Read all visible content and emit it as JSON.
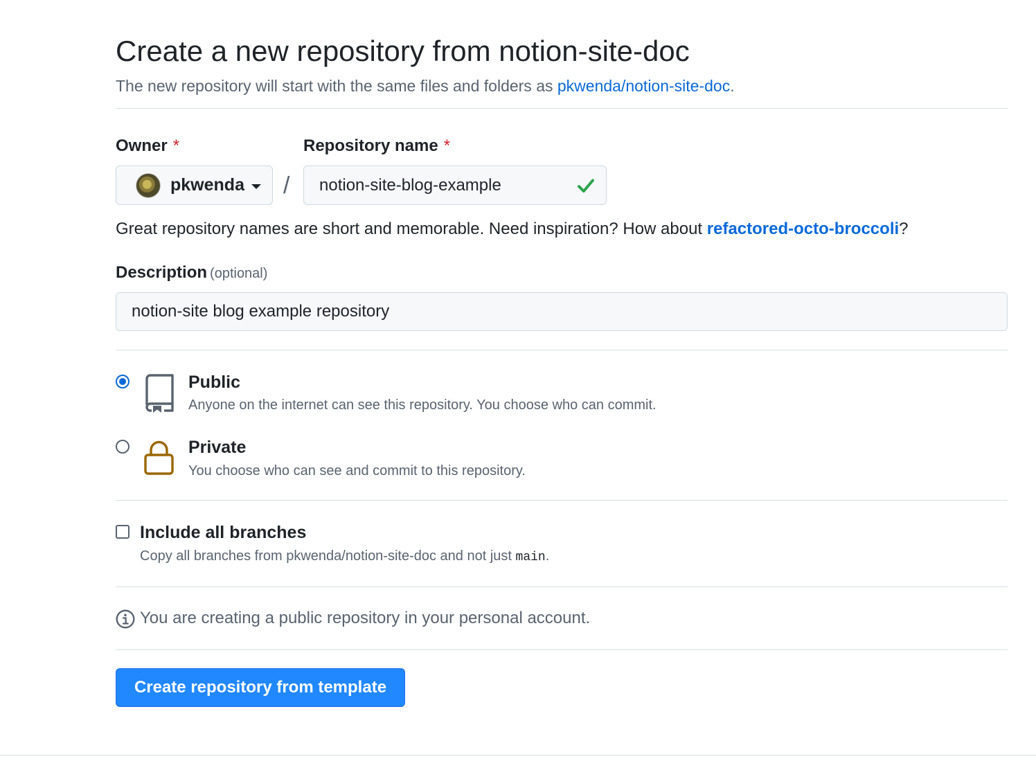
{
  "header": {
    "title": "Create a new repository from notion-site-doc",
    "subtitle_prefix": "The new repository will start with the same files and folders as ",
    "template_link": "pkwenda/notion-site-doc",
    "subtitle_suffix": "."
  },
  "owner": {
    "label": "Owner",
    "required_mark": "*",
    "value": "pkwenda"
  },
  "separator": "/",
  "repository_name": {
    "label": "Repository name",
    "required_mark": "*",
    "value": "notion-site-blog-example"
  },
  "name_hint": {
    "prefix": "Great repository names are short and memorable. Need inspiration? How about ",
    "suggestion": "refactored-octo-broccoli",
    "suffix": "?"
  },
  "description": {
    "label": "Description",
    "optional": "(optional)",
    "value": "notion-site blog example repository"
  },
  "visibility": {
    "public": {
      "title": "Public",
      "description": "Anyone on the internet can see this repository. You choose who can commit.",
      "selected": true
    },
    "private": {
      "title": "Private",
      "description": "You choose who can see and commit to this repository.",
      "selected": false
    }
  },
  "include_branches": {
    "title": "Include all branches",
    "description_prefix": "Copy all branches from pkwenda/notion-site-doc and not just ",
    "branch": "main",
    "description_suffix": ".",
    "checked": false
  },
  "info": {
    "text": "You are creating a public repository in your personal account."
  },
  "submit": {
    "label": "Create repository from template"
  },
  "colors": {
    "accent": "#0969da",
    "button": "#2188ff",
    "success": "#1a7f37",
    "lock": "#9a6700",
    "required": "#d1242f"
  },
  "icons": {
    "public": "repo-icon",
    "private": "lock-icon",
    "valid": "check-icon",
    "info": "info-icon",
    "dropdown": "triangle-down-icon"
  }
}
